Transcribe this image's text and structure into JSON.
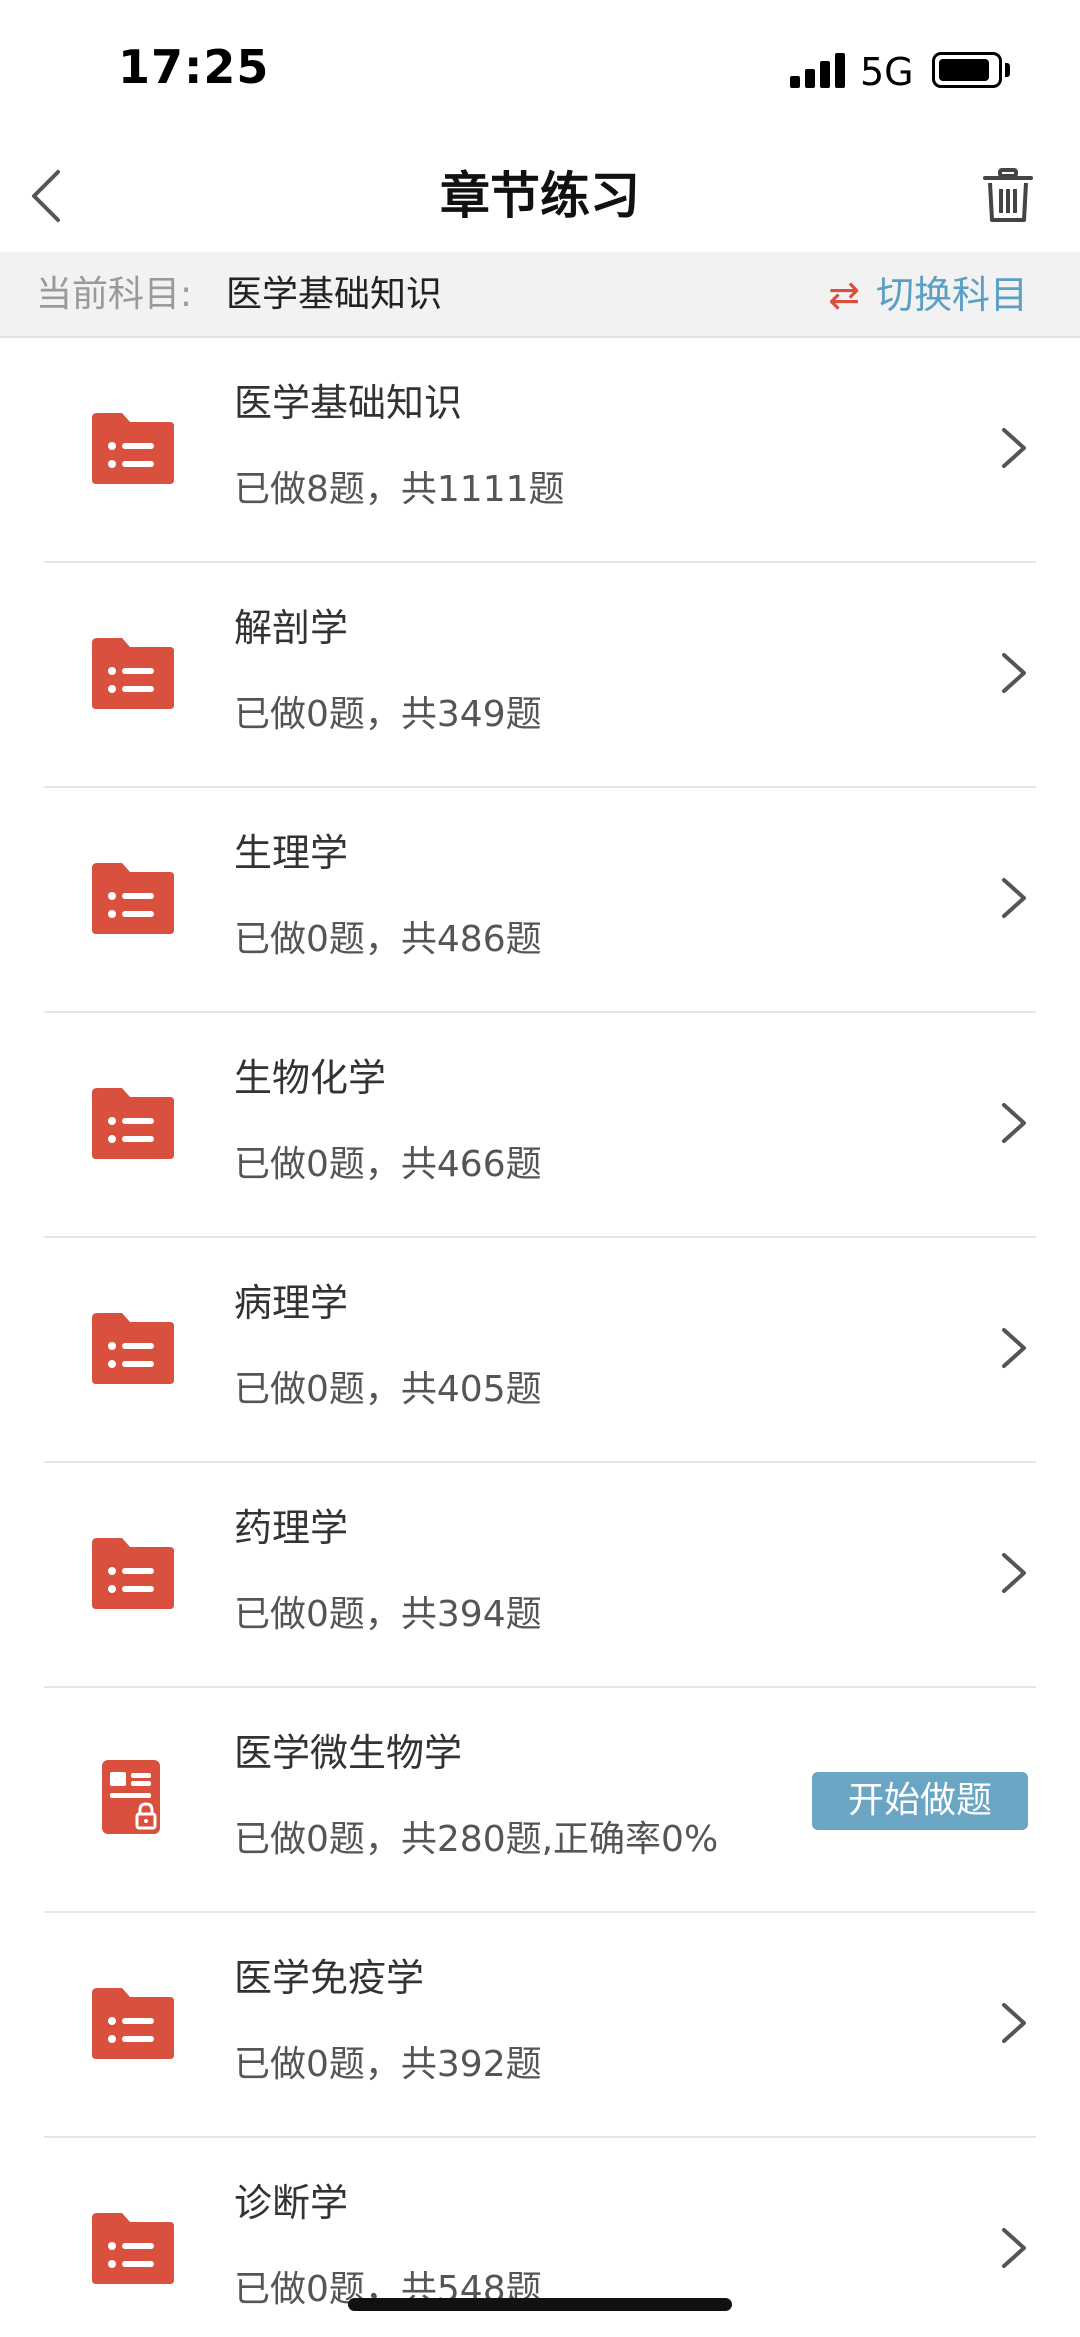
{
  "status_bar": {
    "time": "17:25",
    "network": "5G",
    "icons": [
      "signal-icon",
      "battery-icon"
    ]
  },
  "nav": {
    "title": "章节练习",
    "back_icon": "chevron-left-icon",
    "delete_icon": "trash-icon"
  },
  "subject": {
    "label": "当前科目:",
    "name": "医学基础知识",
    "switch_label": "切换科目",
    "switch_icon": "swap-arrows-icon"
  },
  "colors": {
    "accent_red": "#d9503f",
    "accent_blue": "#5a9fc4",
    "button_blue": "#6aa6c3"
  },
  "chapters": [
    {
      "title": "医学基础知识",
      "stats": "已做8题，共1111题",
      "icon": "folder-list-icon"
    },
    {
      "title": "解剖学",
      "stats": "已做0题，共349题",
      "icon": "folder-list-icon"
    },
    {
      "title": "生理学",
      "stats": "已做0题，共486题",
      "icon": "folder-list-icon"
    },
    {
      "title": "生物化学",
      "stats": "已做0题，共466题",
      "icon": "folder-list-icon"
    },
    {
      "title": "病理学",
      "stats": "已做0题，共405题",
      "icon": "folder-list-icon"
    },
    {
      "title": "药理学",
      "stats": "已做0题，共394题",
      "icon": "folder-list-icon"
    },
    {
      "title": "医学微生物学",
      "stats": "已做0题，共280题,正确率0%",
      "icon": "locked-paper-icon",
      "action_label": "开始做题"
    },
    {
      "title": "医学免疫学",
      "stats": "已做0题，共392题",
      "icon": "folder-list-icon"
    },
    {
      "title": "诊断学",
      "stats": "已做0题，共548题",
      "icon": "folder-list-icon"
    }
  ]
}
